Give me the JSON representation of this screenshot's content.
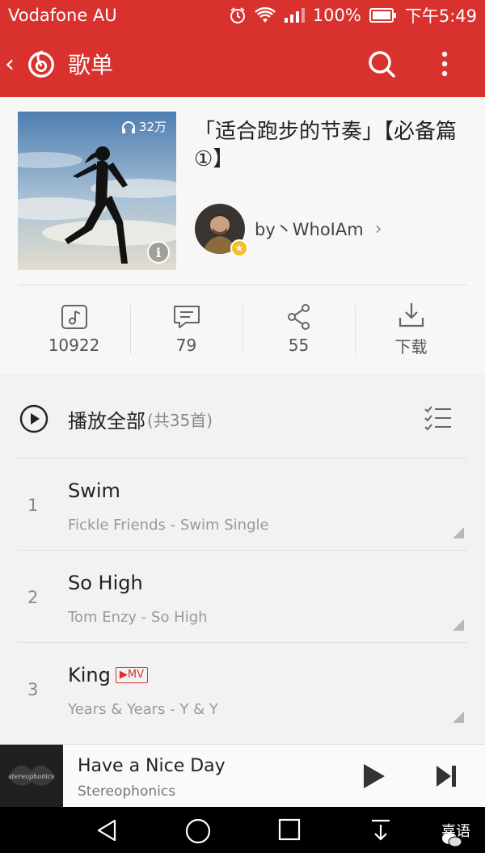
{
  "status_bar": {
    "carrier": "Vodafone AU",
    "battery": "100%",
    "time": "下午5:49"
  },
  "app_bar": {
    "title": "歌单",
    "icons": [
      "back-icon",
      "netease-logo-icon",
      "search-icon",
      "more-vert-icon"
    ]
  },
  "playlist": {
    "title": "「适合跑步的节奏」【必备篇①】",
    "play_count": "32万",
    "creator": "by丶WhoIAm",
    "colors": {
      "accent": "#d9322e",
      "badge": "#f3c027"
    }
  },
  "stats": [
    {
      "icon": "music-note-icon",
      "value": "10922"
    },
    {
      "icon": "comment-icon",
      "value": "79"
    },
    {
      "icon": "share-icon",
      "value": "55"
    },
    {
      "icon": "download-icon",
      "value": "下载"
    }
  ],
  "play_all": {
    "label": "播放全部",
    "count": "(共35首)"
  },
  "songs": [
    {
      "index": "1",
      "title": "Swim",
      "subtitle": "Fickle Friends - Swim   Single",
      "mv": ""
    },
    {
      "index": "2",
      "title": "So High",
      "subtitle": "Tom Enzy - So High",
      "mv": ""
    },
    {
      "index": "3",
      "title": "King",
      "subtitle": "Years & Years - Y & Y",
      "mv": "MV"
    }
  ],
  "now_playing": {
    "title": "Have a Nice Day",
    "artist": "Stereophonics",
    "art_label": "stereophonics"
  },
  "watermark": "嘉语"
}
